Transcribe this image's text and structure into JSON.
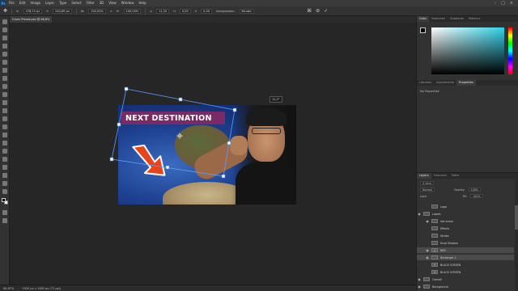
{
  "menubar": {
    "logo": "Ps",
    "items": [
      "File",
      "Edit",
      "Image",
      "Layer",
      "Type",
      "Select",
      "Filter",
      "3D",
      "View",
      "Window",
      "Help"
    ]
  },
  "options": {
    "x_label": "X:",
    "x_value": "478,15 px",
    "y_label": "Y:",
    "y_value": "240,69 px",
    "w_label": "W:",
    "w_value": "100,00%",
    "h_label": "H:",
    "h_value": "100,00%",
    "angle_value": "11,20",
    "h_skew": "0,00",
    "v_skew": "0,00",
    "interp_label": "Interpolation:",
    "interp_value": "Bicubic"
  },
  "document": {
    "tab_title": "Cover Preset.psd @ 66,6% (RGB/8*) *"
  },
  "artwork": {
    "banner_text": "NEXT DESTINATION"
  },
  "transform": {
    "angle_readout": "11,2°"
  },
  "status": {
    "zoom": "66,67%",
    "doc_size": "1920 px x 1080 px (72 ppi)"
  },
  "color_panel": {
    "tabs": [
      "Color",
      "Swatches",
      "Gradients",
      "Patterns"
    ],
    "active": 0
  },
  "props_panel": {
    "tabs": [
      "Libraries",
      "Adjustments",
      "Properties"
    ],
    "active": 2,
    "empty_text": "No Properties"
  },
  "layers_panel": {
    "tabs": [
      "Layers",
      "Channels",
      "Paths"
    ],
    "active": 0,
    "kind_label": "Kind",
    "blend_mode": "Normal",
    "opacity_label": "Opacity:",
    "opacity_value": "100%",
    "lock_label": "Lock:",
    "fill_label": "Fill:",
    "fill_value": "100%",
    "layers": [
      {
        "name": "Logo",
        "sub": true,
        "selected": false,
        "thumb": "",
        "eye": false
      },
      {
        "name": "Labels",
        "sub": false,
        "selected": false,
        "thumb": "",
        "eye": true
      },
      {
        "name": "red arrow",
        "sub": true,
        "selected": false,
        "thumb": "",
        "eye": true
      },
      {
        "name": "Effects",
        "sub": true,
        "selected": false,
        "thumb": "",
        "eye": false
      },
      {
        "name": "Stroke",
        "sub": true,
        "selected": false,
        "thumb": "",
        "eye": false
      },
      {
        "name": "Drop Shadow",
        "sub": true,
        "selected": false,
        "thumb": "",
        "eye": false
      },
      {
        "name": "NEX",
        "sub": true,
        "selected": true,
        "thumb": "T",
        "eye": true
      },
      {
        "name": "Rectangle 1",
        "sub": true,
        "selected": true,
        "thumb": "",
        "eye": true
      },
      {
        "name": "BLACK SCREEN",
        "sub": true,
        "selected": false,
        "thumb": "T",
        "eye": false
      },
      {
        "name": "BLACK SCREEN",
        "sub": true,
        "selected": false,
        "thumb": "T",
        "eye": false
      },
      {
        "name": "Overall",
        "sub": false,
        "selected": false,
        "thumb": "",
        "eye": true
      },
      {
        "name": "Background",
        "sub": false,
        "selected": false,
        "thumb": "",
        "eye": true
      }
    ]
  },
  "colors": {
    "accent_banner": "#7a2a66",
    "arrow": "#e8441a",
    "picker_hue": "#2fd3ea"
  }
}
